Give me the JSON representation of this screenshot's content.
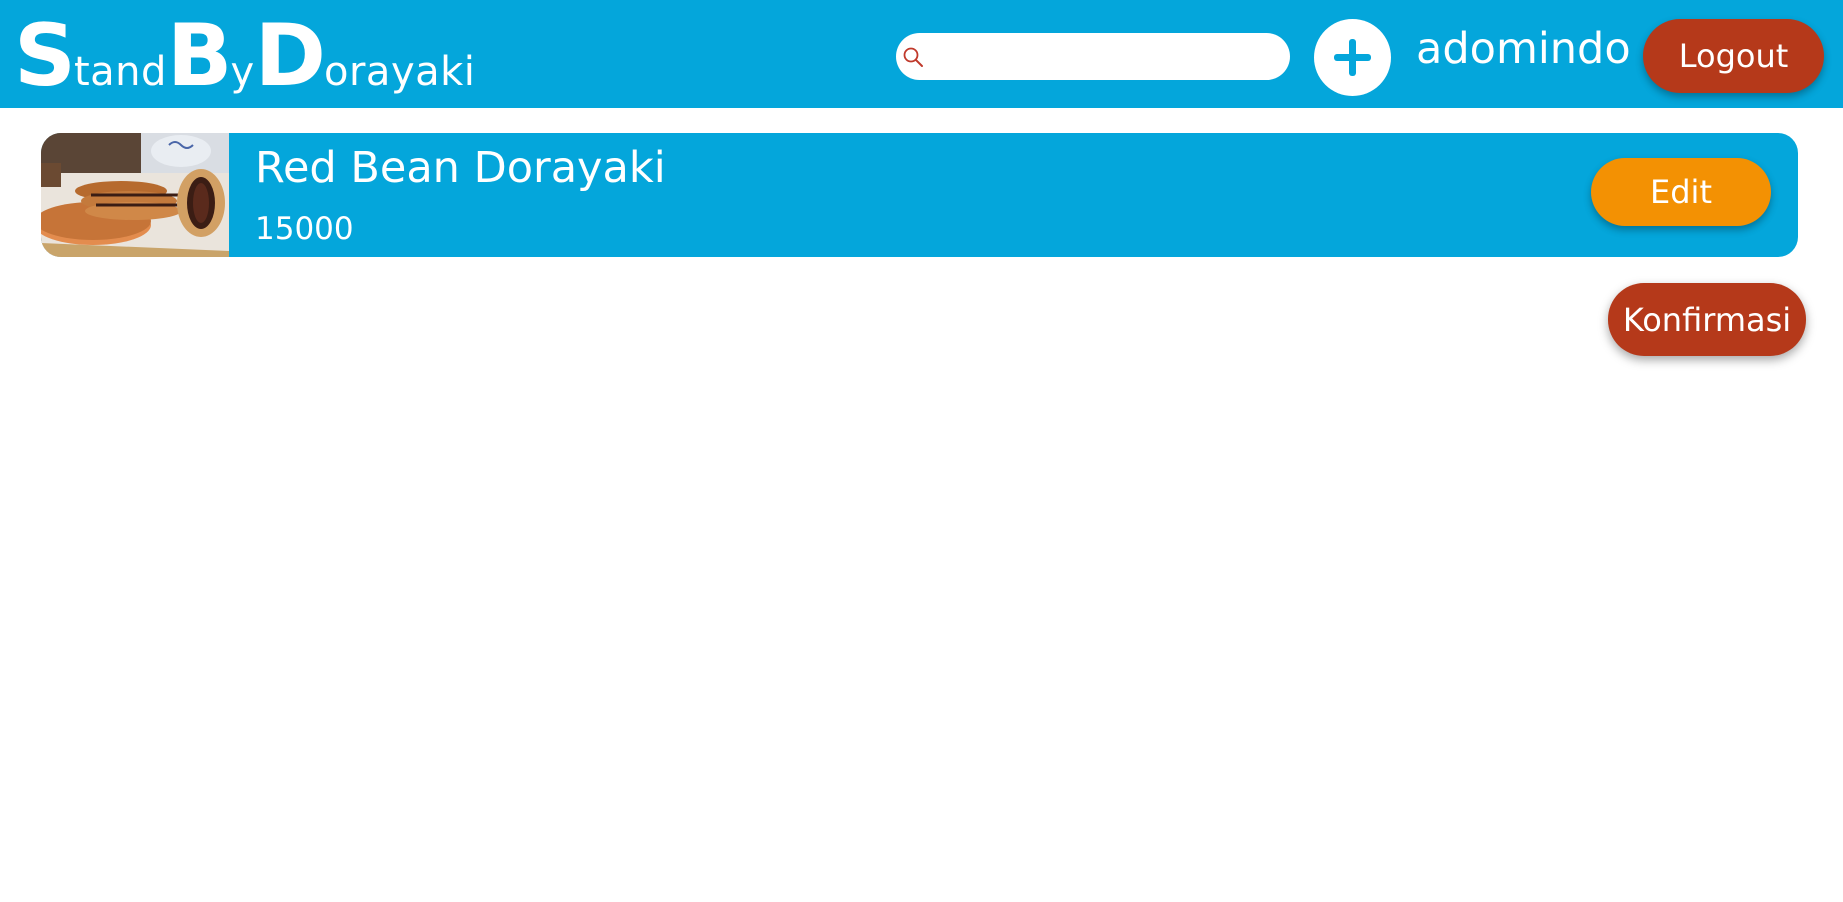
{
  "brand": {
    "parts": [
      {
        "letter": "S",
        "rest": "tand"
      },
      {
        "letter": "B",
        "rest": "y"
      },
      {
        "letter": "D",
        "rest": "orayaki"
      }
    ]
  },
  "search": {
    "value": "",
    "placeholder": "",
    "icon": "search-icon"
  },
  "header": {
    "add_icon": "plus-icon",
    "username": "adomindo",
    "logout_label": "Logout"
  },
  "products": [
    {
      "name": "Red Bean Dorayaki",
      "price": "15000",
      "image": "dorayaki-photo",
      "edit_label": "Edit"
    }
  ],
  "actions": {
    "confirm_label": "Konfirmasi"
  },
  "colors": {
    "primary": "#04a6db",
    "danger": "#b5391a",
    "accent": "#f39103",
    "text": "#ffffff",
    "search_icon": "#c0392b"
  }
}
